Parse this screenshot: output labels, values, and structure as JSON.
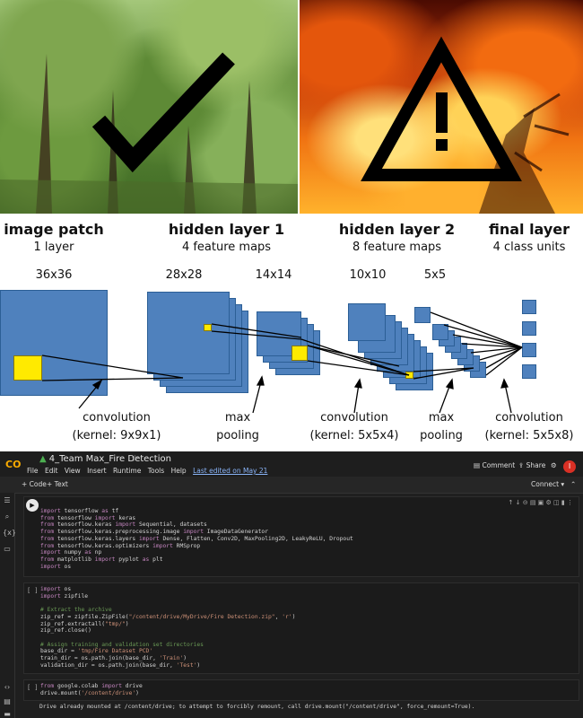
{
  "diagram": {
    "stages": [
      {
        "title": "image patch",
        "subtitle": "1 layer"
      },
      {
        "title": "hidden layer 1",
        "subtitle": "4 feature maps"
      },
      {
        "title": "hidden layer 2",
        "subtitle": "8 feature maps"
      },
      {
        "title": "final layer",
        "subtitle": "4 class units"
      }
    ],
    "dims": [
      "36x36",
      "28x28",
      "14x14",
      "10x10",
      "5x5"
    ],
    "operations": [
      {
        "line1": "convolution",
        "line2": "(kernel: 9x9x1)"
      },
      {
        "line1": "max",
        "line2": "pooling"
      },
      {
        "line1": "convolution",
        "line2": "(kernel: 5x5x4)"
      },
      {
        "line1": "max",
        "line2": "pooling"
      },
      {
        "line1": "convolution",
        "line2": "(kernel: 5x5x8)"
      }
    ],
    "colors": {
      "map_fill": "#4f81bd",
      "map_border": "#2c5f96",
      "highlight": "#ffea00"
    }
  },
  "colab": {
    "logo": "CO",
    "notebook_title": "4_Team Max_Fire Detection",
    "menu": [
      "File",
      "Edit",
      "View",
      "Insert",
      "Runtime",
      "Tools",
      "Help"
    ],
    "last_edited": "Last edited on May 21",
    "comment_label": "Comment",
    "share_label": "Share",
    "avatar_letter": "I",
    "add_code": "+ Code",
    "add_text": "+ Text",
    "connect_label": "Connect",
    "cell_empty_bracket": "[ ]",
    "output_text": "Drive already mounted at /content/drive; to attempt to forcibly remount, call drive.mount(\"/content/drive\", force_remount=True)."
  }
}
